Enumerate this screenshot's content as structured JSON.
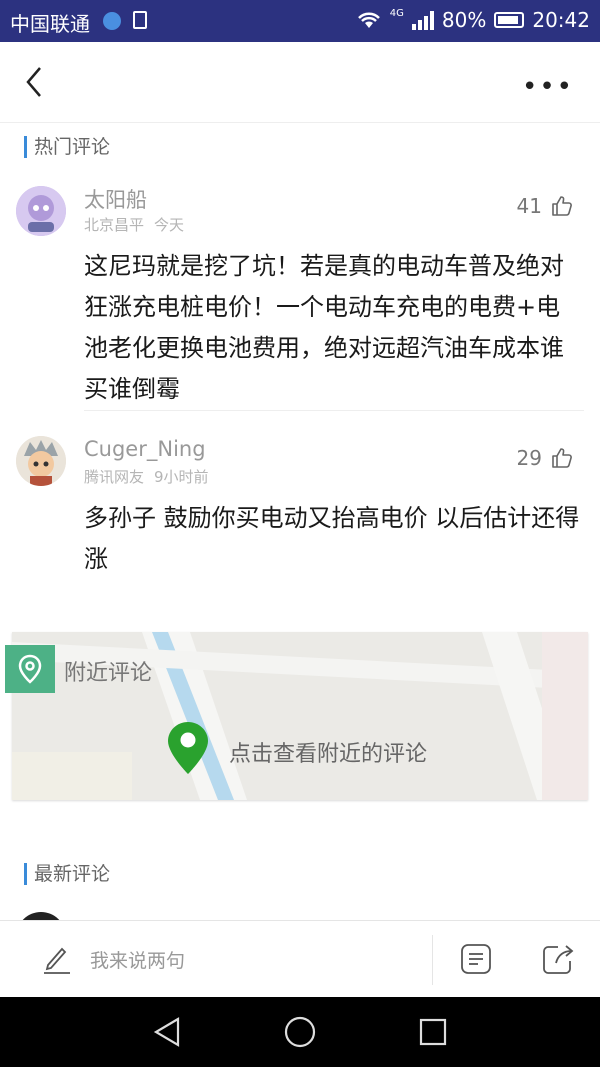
{
  "status": {
    "carrier": "中国联通",
    "network": "4G",
    "battery": "80%",
    "battery_level": 0.8,
    "time": "20:42"
  },
  "nav": {
    "back_icon": "chevron-left-icon",
    "more_icon": "more-horizontal-icon"
  },
  "hot_section": {
    "title": "热门评论"
  },
  "comments": [
    {
      "user": "太阳船",
      "location": "北京昌平",
      "time": "今天",
      "likes": "41",
      "text": "这尼玛就是挖了坑！若是真的电动车普及绝对狂涨充电桩电价！一个电动车充电的电费+电池老化更换电池费用，绝对远超汽油车成本谁买谁倒霉"
    },
    {
      "user": "Cuger_Ning",
      "location": "腾讯网友",
      "time": "9小时前",
      "likes": "29",
      "text": "多孙子 鼓励你买电动又抬高电价 以后估计还得涨"
    }
  ],
  "nearby": {
    "label": "附近评论",
    "cta": "点击查看附近的评论",
    "pin_color": "#2aa22e",
    "tag_color": "#4db186"
  },
  "latest_section": {
    "title": "最新评论"
  },
  "bottom": {
    "placeholder": "我来说两句",
    "compose_icon": "pen-icon",
    "list_icon": "comment-list-icon",
    "share_icon": "share-icon"
  },
  "accent": "#3a8bd9"
}
